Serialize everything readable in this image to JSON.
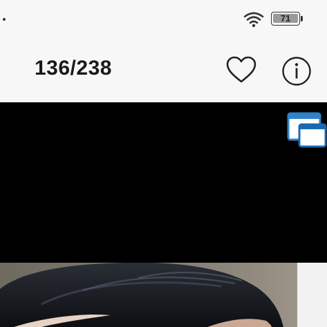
{
  "status_bar": {
    "battery_level": "71"
  },
  "header": {
    "counter": "136/238"
  },
  "icons": {
    "wifi": "wifi-icon",
    "battery": "battery-icon",
    "favorite": "heart-icon",
    "info": "info-icon",
    "multiwindow": "multi-window-icon"
  },
  "colors": {
    "multiwindow_accent": "#2f82c8"
  }
}
